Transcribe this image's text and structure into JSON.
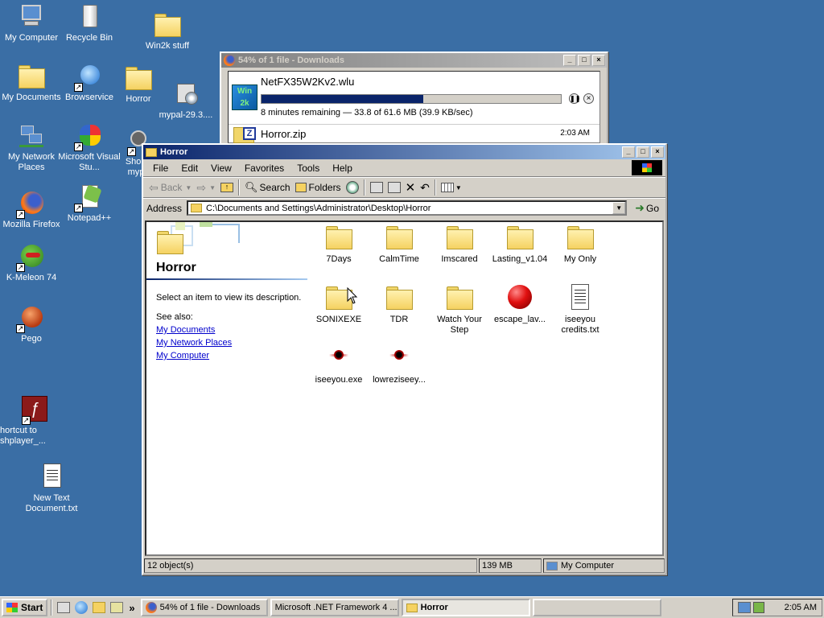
{
  "desktop": {
    "icons": [
      {
        "label": "My Computer"
      },
      {
        "label": "Recycle Bin"
      },
      {
        "label": "Win2k stuff"
      },
      {
        "label": "My Documents"
      },
      {
        "label": "Browservice"
      },
      {
        "label": "Horror"
      },
      {
        "label": "mypal-29.3...."
      },
      {
        "label": "My Network Places"
      },
      {
        "label": "Microsoft Visual Stu..."
      },
      {
        "label": "Short myp"
      },
      {
        "label": "Mozilla Firefox"
      },
      {
        "label": "Notepad++"
      },
      {
        "label": "K-Meleon 74"
      },
      {
        "label": "Pego"
      },
      {
        "label": "hortcut to shplayer_..."
      },
      {
        "label": "New Text Document.txt"
      }
    ]
  },
  "downloads": {
    "title": "54% of 1 file - Downloads",
    "items": [
      {
        "name": "NetFX35W2Kv2.wlu",
        "status": "8 minutes remaining — 33.8 of 61.6 MB (39.9 KB/sec)",
        "progress_fraction": 0.54
      },
      {
        "name": "Horror.zip",
        "time": "2:03 AM"
      }
    ]
  },
  "explorer": {
    "title": "Horror",
    "menu": [
      "File",
      "Edit",
      "View",
      "Favorites",
      "Tools",
      "Help"
    ],
    "toolbar": {
      "back": "Back",
      "search": "Search",
      "folders": "Folders"
    },
    "address_label": "Address",
    "address_value": "C:\\Documents and Settings\\Administrator\\Desktop\\Horror",
    "go_label": "Go",
    "left_pane": {
      "heading": "Horror",
      "description": "Select an item to view its description.",
      "see_also_label": "See also:",
      "links": [
        "My Documents",
        "My Network Places",
        "My Computer"
      ]
    },
    "files": [
      {
        "name": "7Days",
        "kind": "folder"
      },
      {
        "name": "CalmTime",
        "kind": "folder"
      },
      {
        "name": "Imscared",
        "kind": "folder"
      },
      {
        "name": "Lasting_v1.04",
        "kind": "folder"
      },
      {
        "name": "My Only",
        "kind": "folder"
      },
      {
        "name": "SONIXEXE",
        "kind": "folder"
      },
      {
        "name": "TDR",
        "kind": "folder"
      },
      {
        "name": "Watch Your Step",
        "kind": "folder"
      },
      {
        "name": "escape_lav...",
        "kind": "red-ball"
      },
      {
        "name": "iseeyou credits.txt",
        "kind": "text"
      },
      {
        "name": "iseeyou.exe",
        "kind": "eye"
      },
      {
        "name": "lowreziseey...",
        "kind": "eye"
      }
    ],
    "status": {
      "objects": "12 object(s)",
      "size": "139 MB",
      "zone": "My Computer"
    }
  },
  "taskbar": {
    "start_label": "Start",
    "quicklaunch_more": "»",
    "tasks": [
      {
        "label": "54% of 1 file - Downloads"
      },
      {
        "label": "Microsoft .NET Framework 4 ..."
      },
      {
        "label": "Horror"
      },
      {
        "label": ""
      }
    ],
    "clock": "2:05 AM"
  }
}
